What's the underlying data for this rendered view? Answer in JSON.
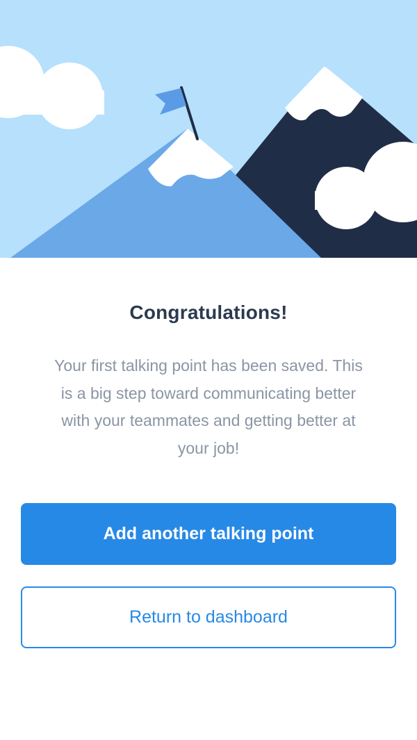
{
  "hero": {
    "illustration": "mountain-summit-flag-illustration",
    "colors": {
      "sky": "#b6e0fc",
      "front_mountain": "#6aa8e8",
      "back_mountain": "#202d47",
      "snow_and_clouds": "#ffffff",
      "flag": "#5b9be6",
      "flag_pole": "#202d47"
    }
  },
  "content": {
    "title": "Congratulations!",
    "message_lines": [
      "Your first talking point has been saved. This",
      "is a big step toward communicating better",
      "with your teammates and getting better at",
      "your job!"
    ]
  },
  "actions": {
    "primary_label": "Add another talking point",
    "secondary_label": "Return to dashboard"
  },
  "colors": {
    "accent": "#2789e6",
    "title_text": "#2b3a4f",
    "body_text": "#8a95a4",
    "background": "#ffffff"
  }
}
